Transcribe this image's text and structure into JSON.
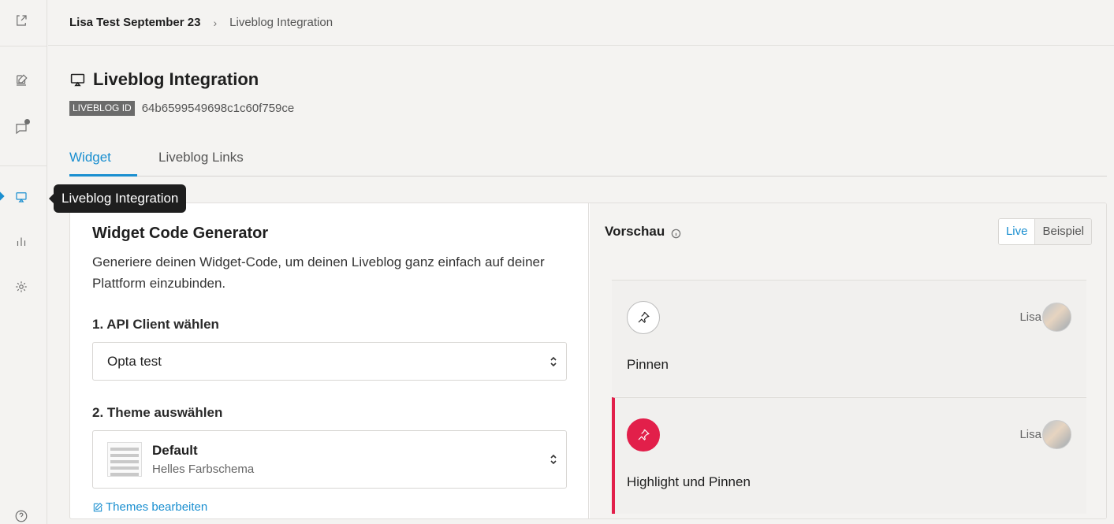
{
  "sidebar": {
    "tooltip": "Liveblog Integration"
  },
  "breadcrumb": {
    "items": [
      "Lisa Test September 23",
      "Liveblog Integration"
    ],
    "separator": "›"
  },
  "page": {
    "title": "Liveblog Integration",
    "id_label": "LIVEBLOG ID",
    "id_value": "64b6599549698c1c60f759ce"
  },
  "tabs": [
    {
      "label": "Widget",
      "active": true
    },
    {
      "label": "Liveblog Links",
      "active": false
    }
  ],
  "generator": {
    "title": "Widget Code Generator",
    "description": "Generiere deinen Widget-Code, um deinen Liveblog ganz einfach auf deiner Plattform einzubinden.",
    "step1_label": "1. API Client wählen",
    "api_client_value": "Opta test",
    "step2_label": "2. Theme auswählen",
    "theme_name": "Default",
    "theme_subtitle": "Helles Farbschema",
    "edit_themes_label": "Themes bearbeiten"
  },
  "preview": {
    "title": "Vorschau",
    "toggle_live": "Live",
    "toggle_example": "Beispiel",
    "posts": [
      {
        "author": "Lisa",
        "text": "Pinnen",
        "highlight": false
      },
      {
        "author": "Lisa",
        "text": "Highlight und Pinnen",
        "highlight": true
      }
    ]
  },
  "colors": {
    "accent": "#1a8fd0",
    "highlight": "#e21f4a"
  }
}
